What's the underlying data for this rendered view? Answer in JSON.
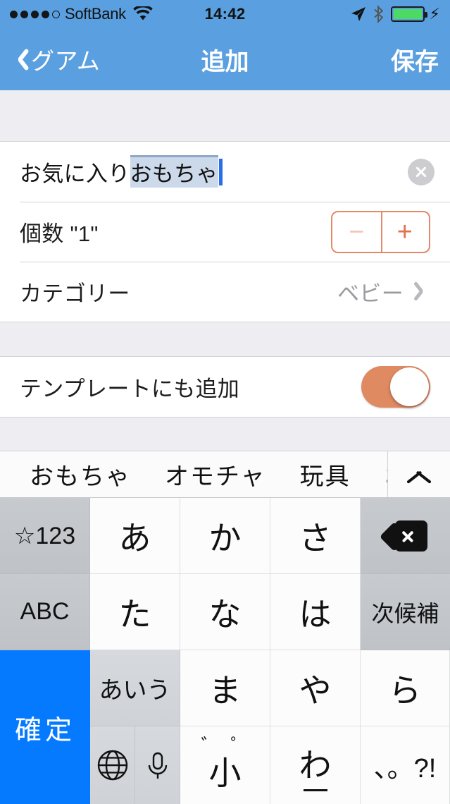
{
  "status_bar": {
    "signal_dots_filled": 4,
    "signal_dots_empty": 1,
    "carrier": "SoftBank",
    "wifi_icon": "wifi-icon",
    "time": "14:42",
    "location_icon": "location-arrow-icon",
    "bluetooth_icon": "bluetooth-icon",
    "battery_icon": "battery-full-icon",
    "charging_icon": "charging-bolt-icon",
    "battery_color": "#4cd964",
    "bar_color": "#5aa0e0"
  },
  "nav_bar": {
    "back_label": "グアム",
    "back_icon": "chevron-left-icon",
    "title": "追加",
    "right_label": "保存"
  },
  "form": {
    "name_field": {
      "committed_text": "お気に入り",
      "marked_text": "おもちゃ",
      "full_value": "お気に入りおもちゃ",
      "placeholder": "",
      "clear_icon": "clear-circle-icon",
      "marked_bg": "#ccd9ea",
      "caret_color": "#2a6fe8"
    },
    "quantity_row": {
      "label": "個数  \"1\"",
      "value": "1",
      "minus_label": "−",
      "plus_label": "+",
      "accent": "#e2896c",
      "minus_disabled": true
    },
    "category_row": {
      "label": "カテゴリー",
      "value": "ベビー",
      "chevron_icon": "chevron-right-icon"
    },
    "template_row": {
      "label": "テンプレートにも追加",
      "toggle_on": true,
      "toggle_color": "#e08a62"
    }
  },
  "candidate_bar": {
    "candidates": [
      "おもちゃ",
      "オモチャ",
      "玩具",
      "お"
    ],
    "expand_icon": "chevron-up-icon"
  },
  "keyboard": {
    "rows": [
      [
        {
          "label": "☆123",
          "name": "key-symbols",
          "style": "fn"
        },
        {
          "label": "あ",
          "name": "key-a",
          "style": "char"
        },
        {
          "label": "か",
          "name": "key-ka",
          "style": "char"
        },
        {
          "label": "さ",
          "name": "key-sa",
          "style": "char"
        },
        {
          "label": "",
          "name": "key-delete",
          "style": "fn",
          "icon": "backspace-icon"
        }
      ],
      [
        {
          "label": "ABC",
          "name": "key-abc",
          "style": "fn"
        },
        {
          "label": "た",
          "name": "key-ta",
          "style": "char"
        },
        {
          "label": "な",
          "name": "key-na",
          "style": "char"
        },
        {
          "label": "は",
          "name": "key-ha",
          "style": "char"
        },
        {
          "label": "次候補",
          "name": "key-next-candidate",
          "style": "fn"
        }
      ],
      [
        {
          "label": "あいう",
          "name": "key-kana-mode",
          "style": "fn-light"
        },
        {
          "label": "ま",
          "name": "key-ma",
          "style": "char"
        },
        {
          "label": "や",
          "name": "key-ya",
          "style": "char"
        },
        {
          "label": "ら",
          "name": "key-ra",
          "style": "char"
        },
        {
          "label": "確定",
          "name": "key-confirm",
          "style": "commit"
        }
      ],
      [
        {
          "label": "",
          "name": "key-globe-mic",
          "style": "fn-light",
          "icon": "globe-icon,microphone-icon"
        },
        {
          "label": "小",
          "marks": "゛゜",
          "name": "key-small-dakuten",
          "style": "char"
        },
        {
          "label": "わ",
          "name": "key-wa",
          "style": "char"
        },
        {
          "label": "、。?!",
          "name": "key-punctuation",
          "style": "char"
        }
      ]
    ],
    "confirm_color": "#057aff",
    "key_bg": "#fcfcfc",
    "fn_key_bg": "#c7cace"
  }
}
